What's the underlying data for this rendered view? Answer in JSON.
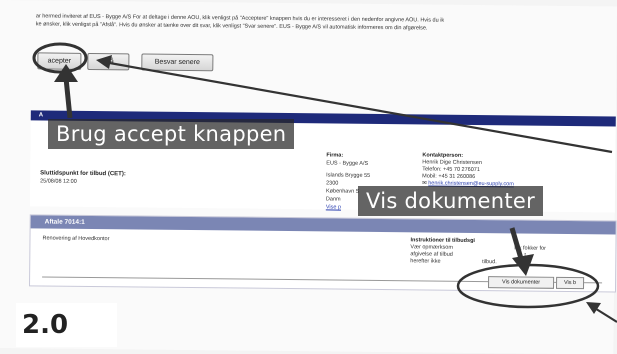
{
  "intro_text": {
    "line1": "ar hermed inviteret af  EUS - Bygge A/S  For at deltage i denne AOU, klik venligst på \"Acceptere\" knappen hvis du er interesseret i den nedenfor angivne AOU. Hvis du ik",
    "line2": "ke ønsker, klik venligst på \"Afslå\". Hvis du ønsker at tænke over dit svar, klik venligst \"Svar senere\".  EUS - Bygge A/S  vil automatisk informeres om din afgørelse."
  },
  "buttons": {
    "accept": "acepter",
    "reject": "fslå",
    "later": "Besvar senere"
  },
  "panel": {
    "head_fragment": "A",
    "deadline_label": "Sluttidspunkt for tilbud (CET):",
    "deadline_value": "25/08/08 12:00",
    "firm": {
      "label": "Firma:",
      "name": "EUS - Bygge A/S",
      "street": "Islands Brygge 55",
      "zip": "2300",
      "city": "København S",
      "country": "Danm",
      "link": "Vise p"
    },
    "contact": {
      "label": "Kontaktperson:",
      "name": "Henrik Dige Christensen",
      "phone": "Telefon: +45 70 276071",
      "mobile": "Mobil: +45 31 260086",
      "email": "henrik.christensen@eu-supply.com"
    }
  },
  "agreement": {
    "header": "Aftale 7014:1",
    "description": "Renovering af Hovedkontor",
    "instr_label": "Instruktioner til tilbudsgi",
    "instr_line1": "Vær opmærksom",
    "instr_line1b": "luk fokker for",
    "instr_line2": "afgivelse af tilbud",
    "instr_line2b": "t",
    "instr_line3": "herefter ikke",
    "instr_line3b": "tilbud.",
    "tab_docs": "Vis dokumenter",
    "tab_other": "Vis b"
  },
  "callouts": {
    "accept": "Brug accept knappen",
    "docs": "Vis dokumenter"
  },
  "badge": "2.0",
  "colors": {
    "panel_header": "#1e2a7a",
    "agreement_header": "#7b86b4",
    "link": "#2a3fb0",
    "callout_bg": "#333333",
    "annotation": "#333333"
  }
}
